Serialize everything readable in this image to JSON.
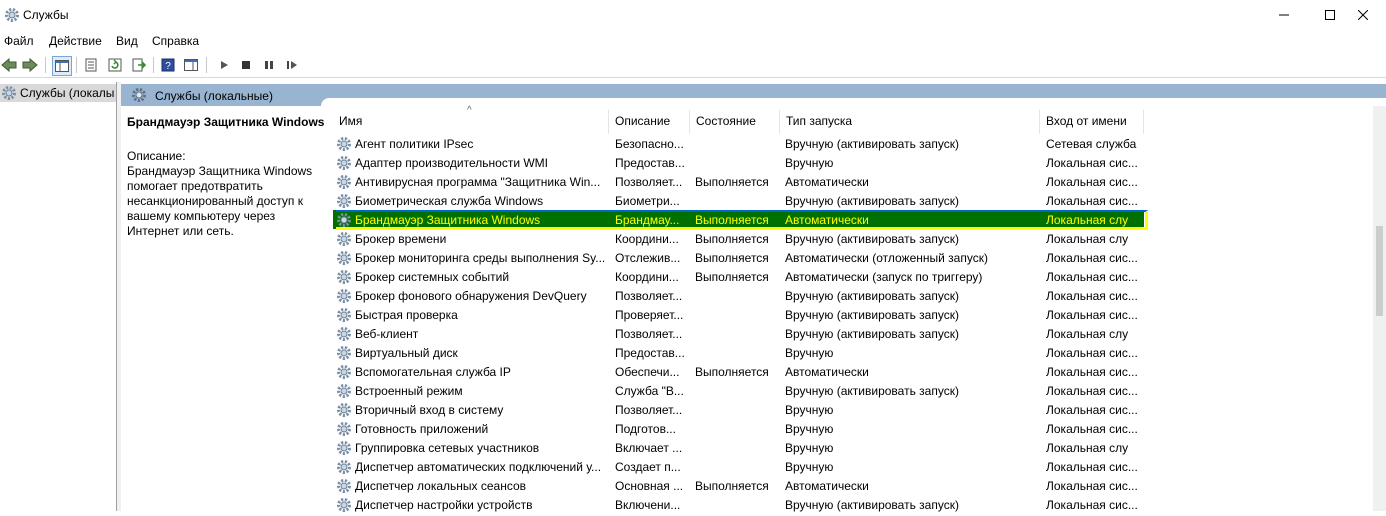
{
  "window": {
    "title": "Службы",
    "icon": "gear-icon"
  },
  "menu": [
    "Файл",
    "Действие",
    "Вид",
    "Справка"
  ],
  "tree": {
    "item_label": "Службы (локалы"
  },
  "panel_header": "Службы (локальные)",
  "details": {
    "title": "Брандмауэр Защитника Windows",
    "description_label": "Описание:",
    "description": "Брандмауэр Защитника Windows помогает предотвратить несанкционированный доступ к вашему компьютеру через Интернет или сеть."
  },
  "columns": {
    "name": "Имя",
    "description": "Описание",
    "status": "Состояние",
    "startup": "Тип запуска",
    "logon": "Вход от имени"
  },
  "services": [
    {
      "name": "Агент политики IPsec",
      "description": "Безопасно...",
      "status": "",
      "startup": "Вручную (активировать запуск)",
      "logon": "Сетевая служба"
    },
    {
      "name": "Адаптер производительности WMI",
      "description": "Предостав...",
      "status": "",
      "startup": "Вручную",
      "logon": "Локальная сис..."
    },
    {
      "name": "Антивирусная программа \"Защитника Win...",
      "description": "Позволяет...",
      "status": "Выполняется",
      "startup": "Автоматически",
      "logon": "Локальная сис..."
    },
    {
      "name": "Биометрическая служба Windows",
      "description": "Биометри...",
      "status": "",
      "startup": "Вручную (активировать запуск)",
      "logon": "Локальная сис..."
    },
    {
      "name": "Брандмауэр Защитника Windows",
      "description": "Брандмау...",
      "status": "Выполняется",
      "startup": "Автоматически",
      "logon": "Локальная слу",
      "selected": true
    },
    {
      "name": "Брокер времени",
      "description": "Координи...",
      "status": "Выполняется",
      "startup": "Вручную (активировать запуск)",
      "logon": "Локальная слу"
    },
    {
      "name": "Брокер мониторинга среды выполнения Sy...",
      "description": "Отслежив...",
      "status": "Выполняется",
      "startup": "Автоматически (отложенный запуск)",
      "logon": "Локальная сис..."
    },
    {
      "name": "Брокер системных событий",
      "description": "Координи...",
      "status": "Выполняется",
      "startup": "Автоматически (запуск по триггеру)",
      "logon": "Локальная сис..."
    },
    {
      "name": "Брокер фонового обнаружения DevQuery",
      "description": "Позволяет...",
      "status": "",
      "startup": "Вручную (активировать запуск)",
      "logon": "Локальная сис..."
    },
    {
      "name": "Быстрая проверка",
      "description": "Проверяет...",
      "status": "",
      "startup": "Вручную (активировать запуск)",
      "logon": "Локальная сис..."
    },
    {
      "name": "Веб-клиент",
      "description": "Позволяет...",
      "status": "",
      "startup": "Вручную (активировать запуск)",
      "logon": "Локальная слу"
    },
    {
      "name": "Виртуальный диск",
      "description": "Предостав...",
      "status": "",
      "startup": "Вручную",
      "logon": "Локальная сис..."
    },
    {
      "name": "Вспомогательная служба IP",
      "description": "Обеспечи...",
      "status": "Выполняется",
      "startup": "Автоматически",
      "logon": "Локальная сис..."
    },
    {
      "name": "Встроенный режим",
      "description": "Служба \"В...",
      "status": "",
      "startup": "Вручную (активировать запуск)",
      "logon": "Локальная сис..."
    },
    {
      "name": "Вторичный вход в систему",
      "description": "Позволяет...",
      "status": "",
      "startup": "Вручную",
      "logon": "Локальная сис..."
    },
    {
      "name": "Готовность приложений",
      "description": "Подготов...",
      "status": "",
      "startup": "Вручную",
      "logon": "Локальная сис..."
    },
    {
      "name": "Группировка сетевых участников",
      "description": "Включает ...",
      "status": "",
      "startup": "Вручную",
      "logon": "Локальная слу"
    },
    {
      "name": "Диспетчер автоматических подключений у...",
      "description": "Создает п...",
      "status": "",
      "startup": "Вручную",
      "logon": "Локальная сис..."
    },
    {
      "name": "Диспетчер локальных сеансов",
      "description": "Основная ...",
      "status": "Выполняется",
      "startup": "Автоматически",
      "logon": "Локальная сис..."
    },
    {
      "name": "Диспетчер настройки устройств",
      "description": "Включени...",
      "status": "",
      "startup": "Вручную (активировать запуск)",
      "logon": "Локальная сис..."
    }
  ]
}
